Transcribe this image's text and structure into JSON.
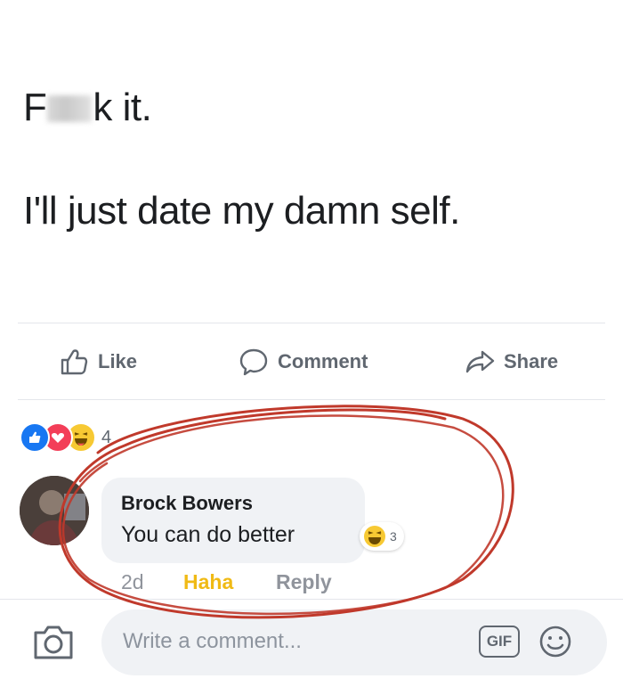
{
  "post": {
    "line1_prefix": "F",
    "line1_suffix": "k it.",
    "line2": "I'll just date my damn self."
  },
  "actions": {
    "like": "Like",
    "comment": "Comment",
    "share": "Share"
  },
  "reactions": {
    "count": "4",
    "types": [
      "like-icon",
      "love-icon",
      "haha-icon"
    ]
  },
  "comment": {
    "author": "Brock Bowers",
    "text": "You can do better",
    "reaction_count": "3",
    "age": "2d",
    "haha_label": "Haha",
    "reply_label": "Reply"
  },
  "composer": {
    "placeholder": "Write a comment...",
    "gif_label": "GIF"
  },
  "colors": {
    "facebook_blue": "#1877f2",
    "haha_yellow": "#f0ba15",
    "annotation_red": "#c0392b",
    "text_secondary": "#606770"
  }
}
